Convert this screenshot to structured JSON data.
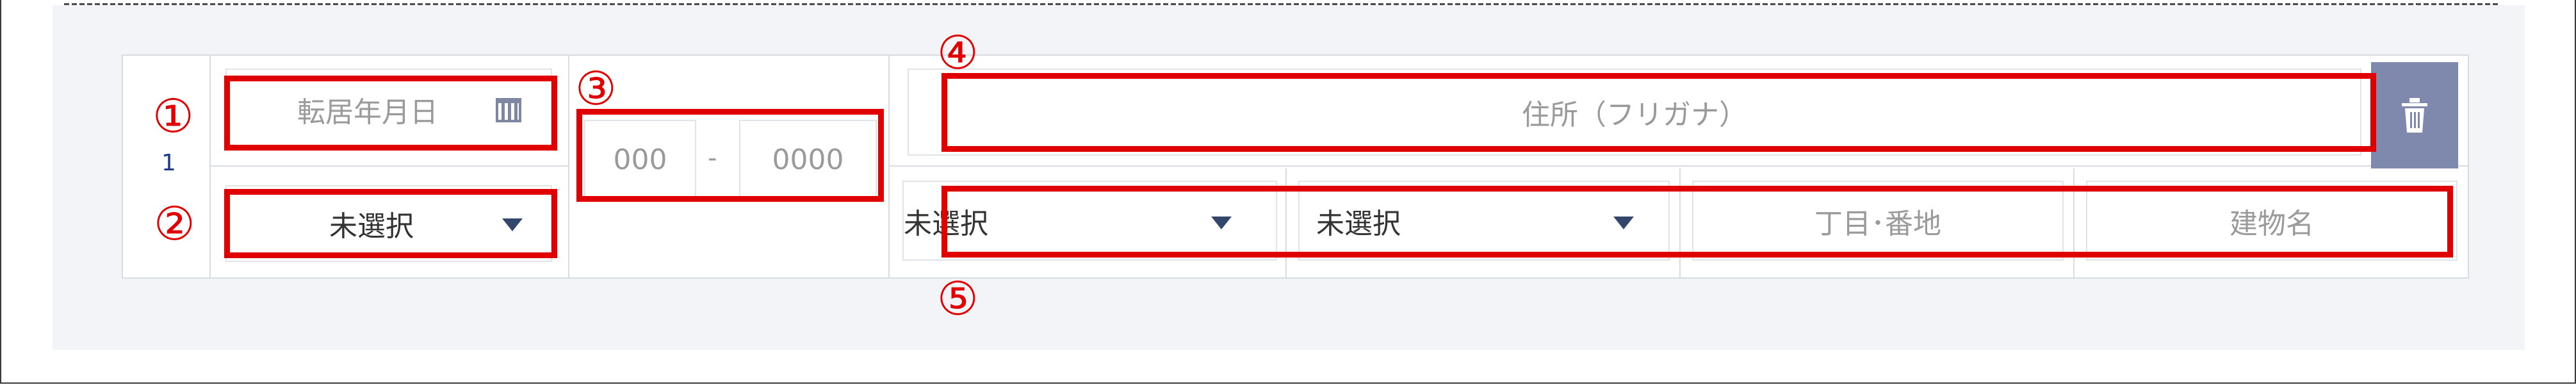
{
  "row": {
    "number": "1"
  },
  "callouts": [
    "①",
    "②",
    "③",
    "④",
    "⑤"
  ],
  "move_date": {
    "placeholder": "転居年月日",
    "icon": "calendar-icon"
  },
  "relationship": {
    "selected": "未選択"
  },
  "postal_code": {
    "first_placeholder": "000",
    "separator": "-",
    "second_placeholder": "0000"
  },
  "address_kana": {
    "placeholder": "住所（フリガナ）"
  },
  "address_parts": [
    {
      "selected": "未選択"
    },
    {
      "selected": "未選択"
    },
    {
      "placeholder": "丁目･番地"
    },
    {
      "placeholder": "建物名"
    }
  ],
  "actions": {
    "delete_icon": "trash-icon"
  },
  "colors": {
    "highlight": "#e00000",
    "delete_button": "#7e89ad",
    "row_number": "#1d3b86"
  }
}
